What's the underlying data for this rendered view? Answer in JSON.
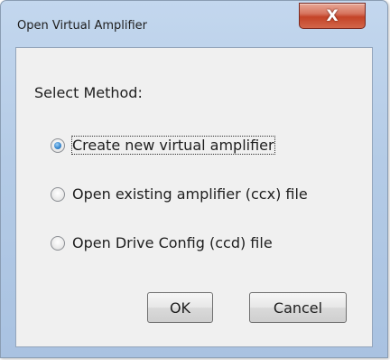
{
  "window": {
    "title": "Open Virtual Amplifier",
    "close_glyph": "X"
  },
  "form": {
    "method_label": "Select Method:",
    "options": [
      {
        "label": "Create new virtual amplifier",
        "selected": true
      },
      {
        "label": "Open existing amplifier (ccx) file",
        "selected": false
      },
      {
        "label": "Open Drive Config (ccd) file",
        "selected": false
      }
    ]
  },
  "buttons": {
    "ok_label": "OK",
    "cancel_label": "Cancel"
  }
}
